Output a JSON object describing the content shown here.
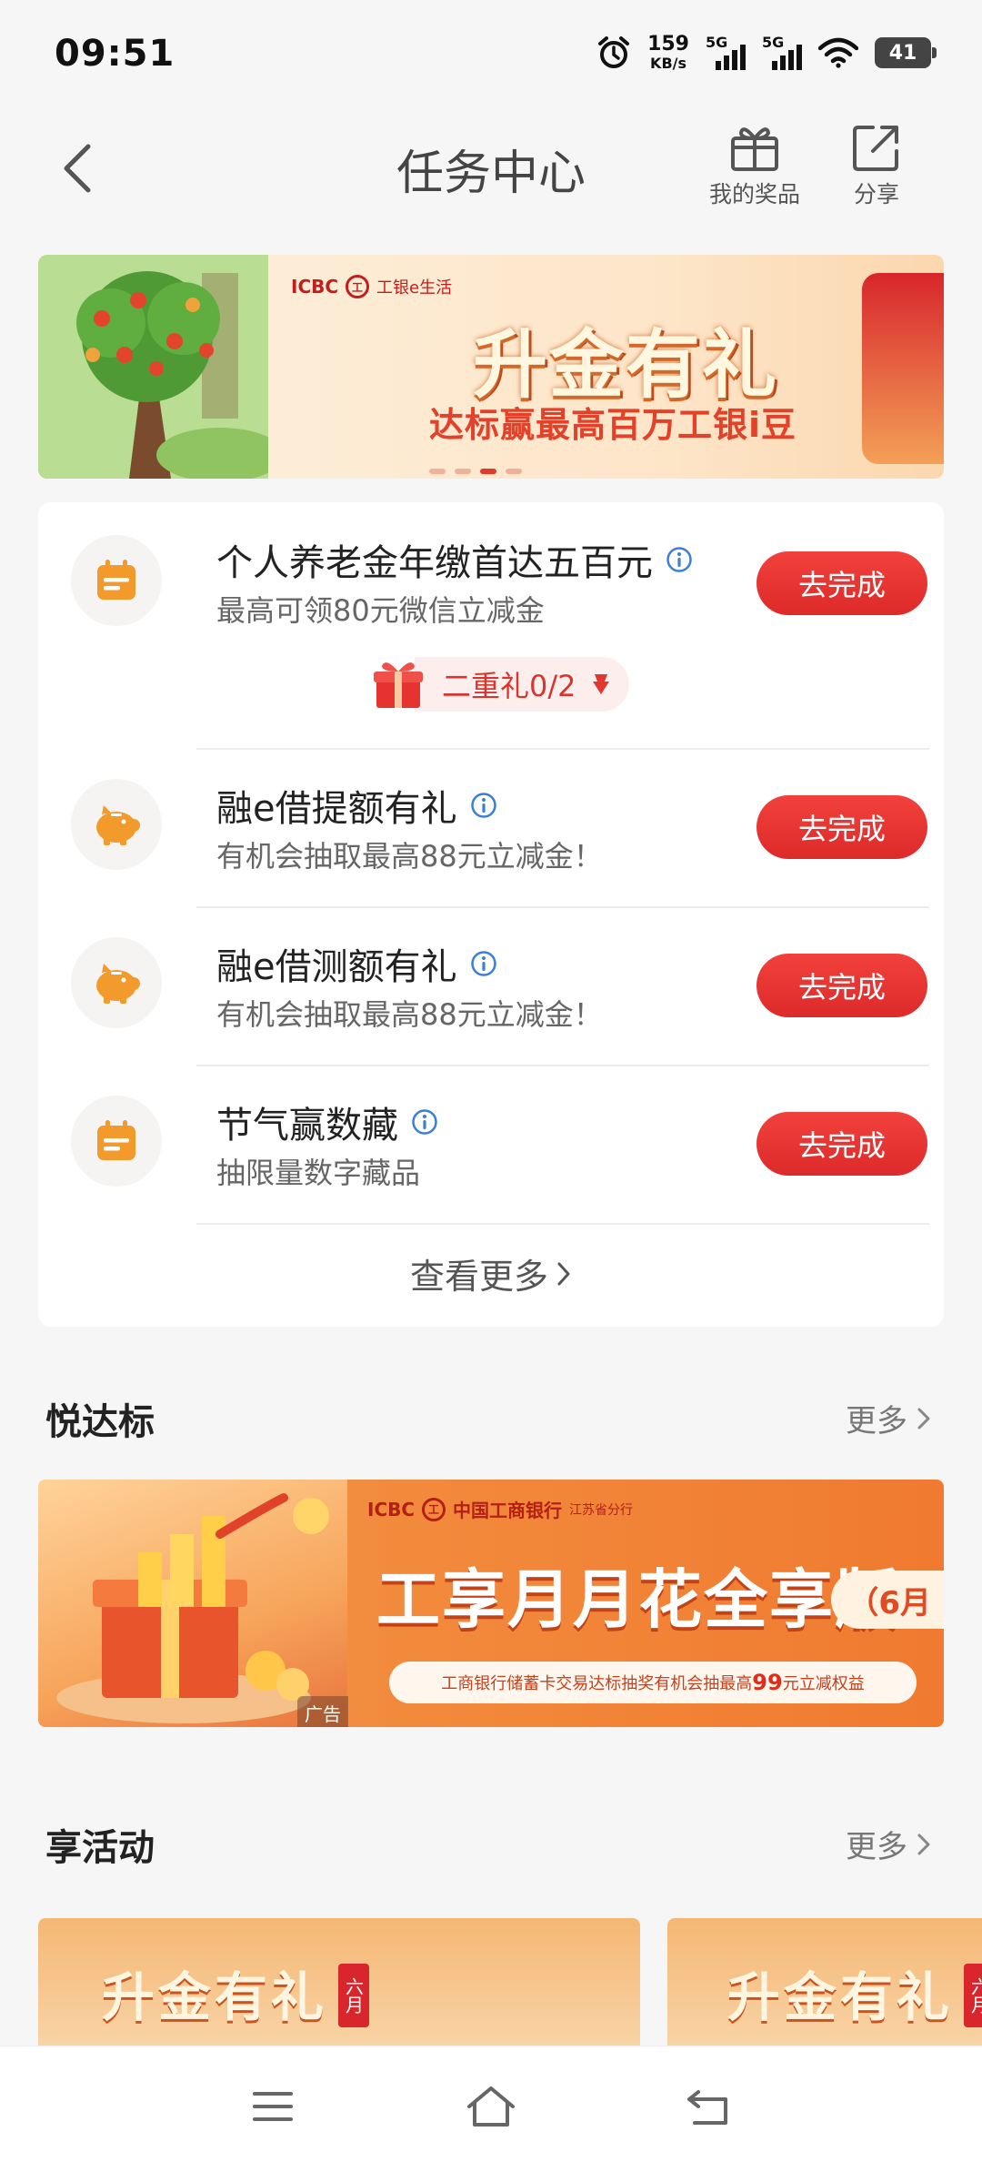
{
  "status_bar": {
    "time": "09:51",
    "net_speed": "159",
    "net_unit": "KB/s",
    "sim1": "5G",
    "sim2": "5G",
    "battery": "41"
  },
  "header": {
    "title": "任务中心",
    "prizes_label": "我的奖品",
    "share_label": "分享"
  },
  "banner": {
    "logo_text": "ICBC",
    "logo_bank": "工银e生活",
    "title": "升金有礼",
    "subtitle": "达标赢最高百万工银i豆",
    "current_slide": 3,
    "slide_count": 4
  },
  "tasks": [
    {
      "title": "个人养老金年缴首达五百元",
      "desc": "最高可领80元微信立减金",
      "button": "去完成",
      "icon": "calendar-icon"
    },
    {
      "title": "融e借提额有礼",
      "desc": "有机会抽取最高88元立减金！",
      "button": "去完成",
      "icon": "piggy-bank-icon"
    },
    {
      "title": "融e借测额有礼",
      "desc": "有机会抽取最高88元立减金！",
      "button": "去完成",
      "icon": "piggy-bank-icon"
    },
    {
      "title": "节气赢数藏",
      "desc": "抽限量数字藏品",
      "button": "去完成",
      "icon": "calendar-icon"
    }
  ],
  "reward_pill": {
    "text": "二重礼0/2"
  },
  "more_tasks": "查看更多",
  "section1": {
    "title": "悦达标",
    "more": "更多"
  },
  "promo": {
    "logo_text": "ICBC",
    "logo_bank": "中国工商银行",
    "logo_branch": "江苏省分行",
    "title": "工享月月花全享版",
    "tag": "（6月",
    "strip_prefix": "工商银行储蓄卡交易达标抽奖有机会抽最高",
    "strip_amount": "99",
    "strip_suffix": "元立减权益",
    "ad_label": "广告"
  },
  "section2": {
    "title": "享活动",
    "more": "更多"
  },
  "activities": [
    {
      "title": "升金有礼",
      "badge": "六月"
    },
    {
      "title": "升金有礼",
      "badge": "六月"
    }
  ],
  "colors": {
    "accent_red": "#e02f2f",
    "icon_orange": "#f39a2c",
    "background": "#f6f6f6"
  }
}
